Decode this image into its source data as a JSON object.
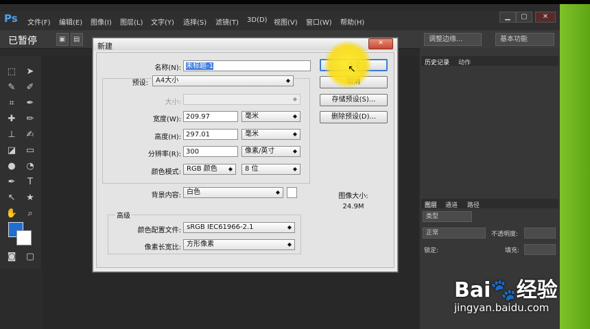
{
  "app": {
    "logo": "Ps",
    "status_text": "已暂停",
    "menu": [
      "文件(F)",
      "编辑(E)",
      "图像(I)",
      "图层(L)",
      "文字(Y)",
      "选择(S)",
      "滤镜(T)",
      "3D(D)",
      "视图(V)",
      "窗口(W)",
      "帮助(H)"
    ],
    "window_buttons": [
      "▁",
      "▢",
      "✕"
    ],
    "options_bar": {
      "refine_edge": "调整边缘...",
      "workspace": "基本功能"
    }
  },
  "panels": {
    "history_tabs": [
      "历史记录",
      "动作"
    ],
    "layers_tabs": [
      "图层",
      "通道",
      "路径"
    ],
    "layers_filter": "类型",
    "blend_mode": "正常",
    "opacity_label": "不透明度:",
    "lock_label": "锁定:",
    "fill_label": "填充:"
  },
  "dialog": {
    "title": "新建",
    "close": "✕",
    "name_label": "名称(N):",
    "name_value": "未标题-1",
    "preset_label": "预设:",
    "preset_value": "A4大小",
    "size_label": "大小:",
    "width_label": "宽度(W):",
    "width_value": "209.97",
    "width_unit": "毫米",
    "height_label": "高度(H):",
    "height_value": "297.01",
    "height_unit": "毫米",
    "resolution_label": "分辨率(R):",
    "resolution_value": "300",
    "resolution_unit": "像素/英寸",
    "color_mode_label": "颜色模式:",
    "color_mode_value": "RGB 颜色",
    "bit_depth_value": "8 位",
    "background_label": "背景内容:",
    "background_value": "白色",
    "advanced_label": "高级",
    "profile_label": "颜色配置文件:",
    "profile_value": "sRGB IEC61966-2.1",
    "pixel_aspect_label": "像素长宽比:",
    "pixel_aspect_value": "方形像素",
    "ok": "确定",
    "cancel": "取消",
    "save_preset": "存储预设(S)...",
    "delete_preset": "删除预设(D)...",
    "image_size_label": "图像大小:",
    "image_size_value": "24.9M"
  },
  "watermark": {
    "brand": "Bai🐾经验",
    "url": "jingyan.baidu.com"
  },
  "colors": {
    "accent": "#1f6ed4",
    "green_edge": "#7ec22a"
  }
}
